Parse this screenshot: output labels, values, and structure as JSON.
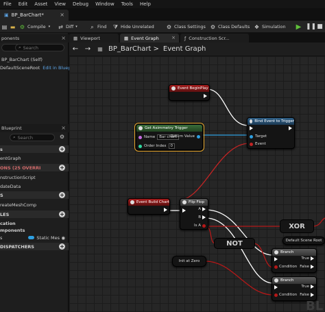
{
  "menu": [
    "File",
    "Edit",
    "Asset",
    "View",
    "Debug",
    "Window",
    "Tools",
    "Help"
  ],
  "doc_tab": {
    "title": "BP_BarChart*"
  },
  "toolbar": {
    "compile": "Compile",
    "diff": "Diff",
    "find": "Find",
    "hide_unrelated": "Hide Unrelated",
    "class_settings": "Class Settings",
    "class_defaults": "Class Defaults",
    "simulation": "Simulation"
  },
  "components": {
    "header": "ponents",
    "search_placeholder": "Search",
    "self_item": "BP_BarChart (Self)",
    "root_item": "DefaultSceneRoot",
    "edit_link": "Edit in Bluepri"
  },
  "my_blueprint": {
    "header": "Blueprint",
    "search_placeholder": "Search",
    "graphs_label": "s",
    "event_graph": "entGraph",
    "functions_label": "ONS (25 OVERRI",
    "construction": "nstructionScript",
    "update_data": "dateData",
    "macros_label": "S",
    "create_mesh": "reateMeshComp",
    "variables_label": "LES",
    "components_label": "cation",
    "components2_label": "mponents",
    "var_name": "s",
    "var_type": "Static Mes",
    "dispatchers_label": "DISPATCHERS"
  },
  "graph_tabs": [
    "Viewport",
    "Event Graph",
    "Construction Scr..."
  ],
  "breadcrumb": {
    "blueprint": "BP_BarChart",
    "sep": ">",
    "graph": "Event Graph"
  },
  "nodes": {
    "begin_play": "Event BeginPlay",
    "get_trigger": {
      "title": "Get Aximmetry Trigger",
      "name_label": "Name",
      "name_value": "Bar chart",
      "order_label": "Order Index",
      "order_value": "0",
      "return_label": "Return Value"
    },
    "bind_event": {
      "title": "Bind Event to Trigger",
      "target": "Target",
      "event": "Event"
    },
    "build_chart": "Event Build Chart",
    "flip_flop": {
      "title": "Flip Flop",
      "a": "A",
      "b": "B",
      "is_a": "Is A"
    },
    "xor": "XOR",
    "not": "NOT",
    "scene_root": "Default Scene Root",
    "int_zero": "Init at Zero",
    "branch1": {
      "title": "Branch",
      "true": "True",
      "false": "False",
      "cond": "Condition"
    },
    "branch2": {
      "title": "Branch",
      "true": "True",
      "false": "False",
      "cond": "Condition"
    },
    "watermark": "BL"
  },
  "colors": {
    "exec": "#ffffff",
    "object": "#2e9fe0",
    "bool": "#b51818",
    "event_red": "#c22424",
    "selected": "#e5a52b"
  }
}
